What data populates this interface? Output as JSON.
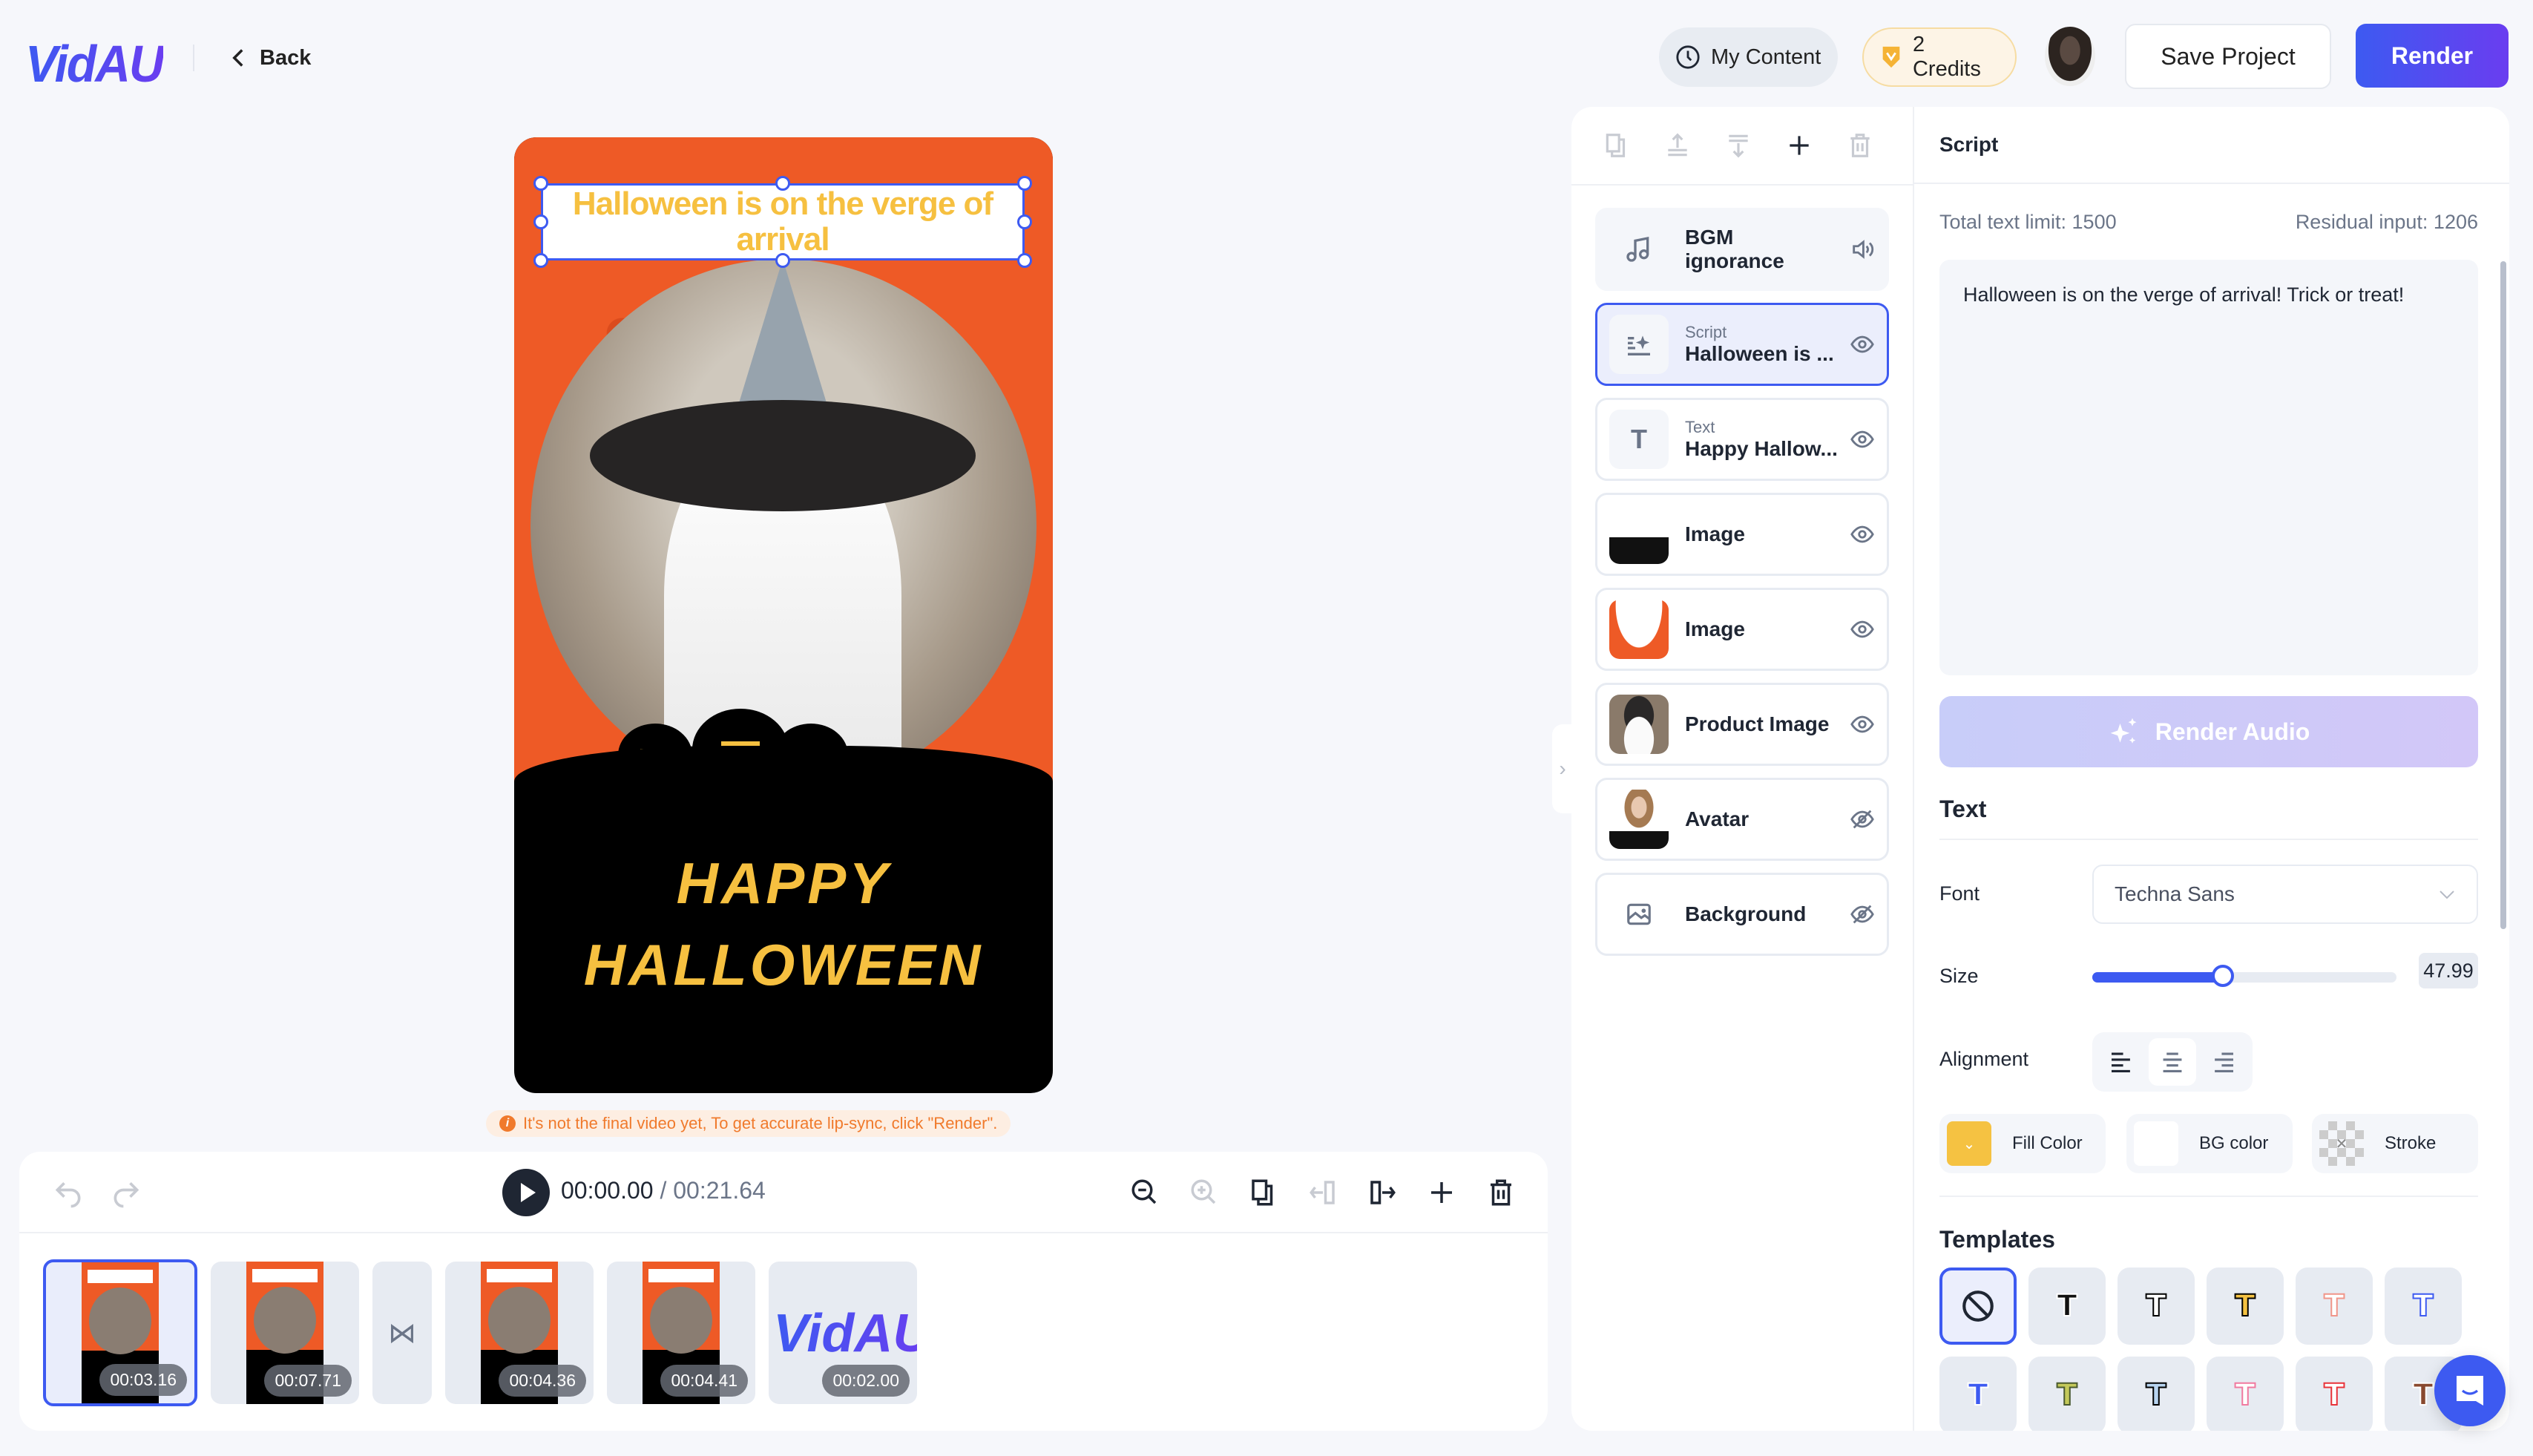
{
  "header": {
    "logo": "VidAU",
    "back_label": "Back",
    "my_content_label": "My Content",
    "credits_label": "2 Credits",
    "save_label": "Save Project",
    "render_label": "Render"
  },
  "canvas": {
    "title_text": "Halloween is on the verge of arrival",
    "happy_line1": "HAPPY",
    "happy_line2": "HALLOWEEN",
    "notice": "It's not the final video yet, To get accurate lip-sync, click \"Render\"."
  },
  "timeline": {
    "current_time": "00:00.00",
    "separator": " / ",
    "total_time": "00:21.64",
    "clips": [
      {
        "duration": "00:03.16",
        "active": true
      },
      {
        "duration": "00:07.71",
        "active": false
      },
      {
        "duration": "00:04.36",
        "active": false
      },
      {
        "duration": "00:04.41",
        "active": false
      },
      {
        "duration": "00:02.00",
        "active": false,
        "logo": "VidAU"
      }
    ],
    "tools": [
      "zoom-out-icon",
      "zoom-in-icon",
      "duplicate-icon",
      "split-left-icon",
      "split-right-icon",
      "add-icon",
      "delete-icon"
    ]
  },
  "layers": {
    "toolbar": [
      "duplicate-icon",
      "move-up-icon",
      "move-down-icon",
      "add-icon",
      "delete-icon"
    ],
    "items": [
      {
        "type": "BGM",
        "name": "ignorance",
        "icon": "music-note-icon",
        "action": "volume-icon"
      },
      {
        "type": "Script",
        "name": "Halloween is ...",
        "icon": "script-sparkle-icon",
        "action": "eye-icon"
      },
      {
        "type": "Text",
        "name": "Happy Hallow...",
        "icon": "text-icon",
        "action": "eye-icon"
      },
      {
        "type": "",
        "name": "Image",
        "icon": "image-thumbnail",
        "action": "eye-icon"
      },
      {
        "type": "",
        "name": "Image",
        "icon": "image-thumbnail",
        "action": "eye-icon"
      },
      {
        "type": "",
        "name": "Product Image",
        "icon": "product-thumbnail",
        "action": "eye-icon"
      },
      {
        "type": "",
        "name": "Avatar",
        "icon": "avatar-thumbnail",
        "action": "eye-off-icon"
      },
      {
        "type": "",
        "name": "Background",
        "icon": "picture-icon",
        "action": "eye-off-icon"
      }
    ]
  },
  "props": {
    "title": "Script",
    "total_limit": "Total text limit: 1500",
    "residual": "Residual input: 1206",
    "script_text": "Halloween is on the verge of arrival! Trick or treat!",
    "render_audio_label": "Render Audio",
    "text_section": "Text",
    "font_label": "Font",
    "font_value": "Techna Sans",
    "size_label": "Size",
    "size_value": "47.99",
    "size_fraction": 0.43,
    "alignment_label": "Alignment",
    "alignment_selected": "center",
    "fill_label": "Fill Color",
    "fill_color": "#f5c242",
    "bg_label": "BG color",
    "bg_color": "#ffffff",
    "stroke_label": "Stroke",
    "templates_label": "Templates",
    "templates": [
      {
        "glyph": "⃠",
        "fill": "",
        "stroke": "",
        "kind": "none"
      },
      {
        "glyph": "T",
        "fill": "#111111",
        "stroke": "#ffffff"
      },
      {
        "glyph": "T",
        "fill": "#ffffff",
        "stroke": "#000000"
      },
      {
        "glyph": "T",
        "fill": "#f5c242",
        "stroke": "#000000"
      },
      {
        "glyph": "T",
        "fill": "#ffffff",
        "stroke": "#f0968a"
      },
      {
        "glyph": "T",
        "fill": "#ffffff",
        "stroke": "#3d5af1"
      },
      {
        "glyph": "T",
        "fill": "#3d5af1",
        "stroke": "#ffffff"
      },
      {
        "glyph": "T",
        "fill": "#c4c95a",
        "stroke": "#4a5a30"
      },
      {
        "glyph": "T",
        "fill": "#b8d4f0",
        "stroke": "#000000"
      },
      {
        "glyph": "T",
        "fill": "#ffffff",
        "stroke": "#f07aa0"
      },
      {
        "glyph": "T",
        "fill": "#ffffff",
        "stroke": "#e8333a"
      },
      {
        "glyph": "T",
        "fill": "#8a4a30",
        "stroke": "#ffffff"
      }
    ]
  },
  "colors": {
    "accent": "#3d5af1",
    "accent_end": "#6a3df0",
    "warning": "#f07a2c"
  }
}
